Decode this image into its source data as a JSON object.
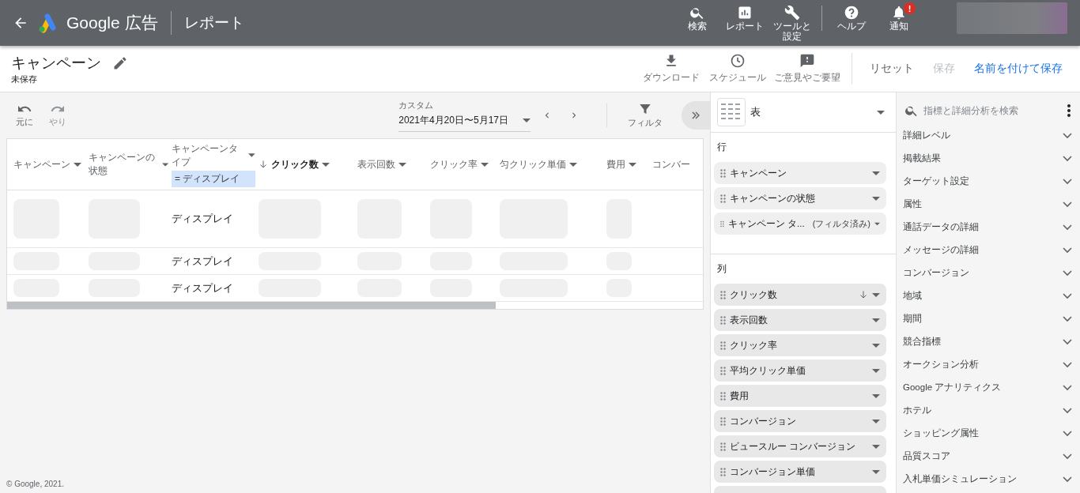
{
  "header": {
    "logo_text": "Google 広告",
    "section": "レポート",
    "nav": [
      {
        "kind": "search",
        "label": "検索"
      },
      {
        "kind": "report",
        "label": "レポート"
      },
      {
        "kind": "tools",
        "label": "ツールと設定"
      },
      {
        "kind": "help",
        "label": "ヘルプ"
      },
      {
        "kind": "bell",
        "label": "通知",
        "badge": "!"
      }
    ]
  },
  "report": {
    "title": "キャンペーン",
    "status": "未保存",
    "actions": [
      {
        "kind": "download",
        "label": "ダウンロード"
      },
      {
        "kind": "schedule",
        "label": "スケジュール"
      },
      {
        "kind": "feedback",
        "label": "ご意見やご要望"
      }
    ],
    "buttons": [
      {
        "label": "リセット",
        "disabled": false,
        "primary": false
      },
      {
        "label": "保存",
        "disabled": true,
        "primary": false
      },
      {
        "label": "名前を付けて保存",
        "disabled": false,
        "primary": true
      }
    ]
  },
  "toolbar": {
    "undo": {
      "label": "元に",
      "disabled": false
    },
    "redo": {
      "label": "やり",
      "disabled": true
    },
    "date_range": {
      "label": "カスタム",
      "value": "2021年4月20日〜5月17日"
    },
    "filter": {
      "label": "フィルタ"
    }
  },
  "table": {
    "columns": [
      {
        "label": "キャンペーン",
        "sorted": false
      },
      {
        "label": "キャンペーンの状態",
        "sorted": false
      },
      {
        "label": "キャンペーンタイプ",
        "sorted": false,
        "filter": "= ディスプレイ"
      },
      {
        "label": "クリック数",
        "sorted": true
      },
      {
        "label": "表示回数",
        "sorted": false
      },
      {
        "label": "クリック率",
        "sorted": false
      },
      {
        "label": "匀クリック単価",
        "sorted": false
      },
      {
        "label": "費用",
        "sorted": false
      },
      {
        "label": "コンバー",
        "sorted": false
      }
    ],
    "rows": [
      {
        "type": "ディスプレイ"
      },
      {
        "type": "ディスプレイ"
      },
      {
        "type": "ディスプレイ"
      }
    ]
  },
  "chart_panel": {
    "chart_type": "表",
    "rows_title": "行",
    "rows": [
      {
        "label": "キャンペーン"
      },
      {
        "label": "キャンペーンの状態"
      },
      {
        "label": "キャンペーン タ...",
        "note": "(フィルタ済み)"
      }
    ],
    "columns_title": "列",
    "columns": [
      {
        "label": "クリック数",
        "sorted": true
      },
      {
        "label": "表示回数",
        "sorted": false
      },
      {
        "label": "クリック率",
        "sorted": false
      },
      {
        "label": "平均クリック単価",
        "sorted": false
      },
      {
        "label": "費用",
        "sorted": false
      },
      {
        "label": "コンバージョン",
        "sorted": false
      },
      {
        "label": "ビュースルー コンバージョン",
        "sorted": false
      },
      {
        "label": "コンバージョン単価",
        "sorted": false
      }
    ]
  },
  "metrics_panel": {
    "search_placeholder": "指標と詳細分析を検索",
    "categories": [
      "詳細レベル",
      "掲載結果",
      "ターゲット設定",
      "属性",
      "通話データの詳細",
      "メッセージの詳細",
      "コンバージョン",
      "地域",
      "期間",
      "競合指標",
      "オークション分析",
      "Google アナリティクス",
      "ホテル",
      "ショッピング属性",
      "品質スコア",
      "入札単価シミュレーション"
    ]
  },
  "footer": "© Google, 2021."
}
